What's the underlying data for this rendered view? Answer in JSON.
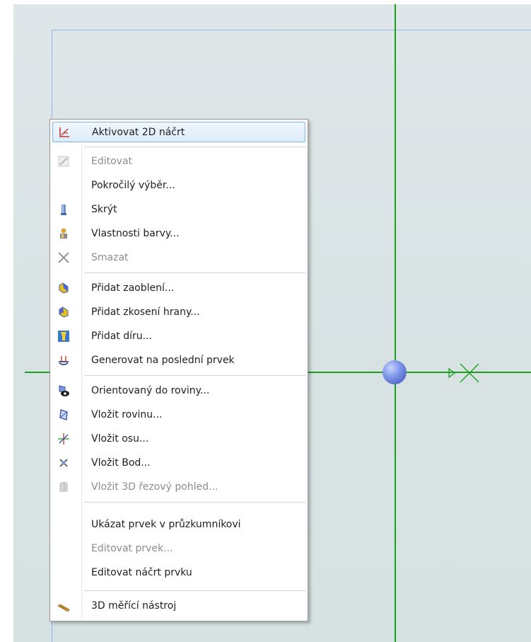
{
  "context_menu": {
    "items": [
      {
        "label": "Aktivovat 2D náčrt",
        "icon": "activate-sketch-icon",
        "enabled": true,
        "hovered": true
      },
      {
        "label": "Editovat",
        "icon": "edit-pencil-icon",
        "enabled": false
      },
      {
        "label": "Pokročilý výběr...",
        "icon": "",
        "enabled": true
      },
      {
        "label": "Skrýt",
        "icon": "hide-icon",
        "enabled": true
      },
      {
        "label": "Vlastnosti barvy...",
        "icon": "color-properties-icon",
        "enabled": true
      },
      {
        "label": "Smazat",
        "icon": "delete-x-icon",
        "enabled": false
      },
      {
        "label": "Přidat zaoblení...",
        "icon": "fillet-icon",
        "enabled": true
      },
      {
        "label": "Přidat zkosení hrany...",
        "icon": "chamfer-icon",
        "enabled": true
      },
      {
        "label": "Přidat díru...",
        "icon": "hole-icon",
        "enabled": true
      },
      {
        "label": "Generovat na poslední prvek",
        "icon": "generate-last-feature-icon",
        "enabled": true
      },
      {
        "label": "Orientovaný do roviny...",
        "icon": "orient-to-plane-icon",
        "enabled": true
      },
      {
        "label": "Vložit rovinu...",
        "icon": "insert-plane-icon",
        "enabled": true
      },
      {
        "label": "Vložit osu...",
        "icon": "insert-axis-icon",
        "enabled": true
      },
      {
        "label": "Vložit Bod...",
        "icon": "insert-point-icon",
        "enabled": true
      },
      {
        "label": "Vložit 3D řezový pohled...",
        "icon": "section-view-icon",
        "enabled": false
      },
      {
        "label": "Ukázat prvek v průzkumníkovi",
        "icon": "",
        "enabled": true
      },
      {
        "label": "Editovat prvek...",
        "icon": "",
        "enabled": false
      },
      {
        "label": "Editovat náčrt prvku",
        "icon": "",
        "enabled": true
      },
      {
        "label": "3D měřící nástroj",
        "icon": "measure-tool-icon",
        "enabled": true
      }
    ]
  },
  "colors": {
    "axis_green": "#1aa01a",
    "frame_blue": "#8fb6e8",
    "hover_border": "#7eb4ea",
    "disabled_text": "#8d8d8d"
  }
}
